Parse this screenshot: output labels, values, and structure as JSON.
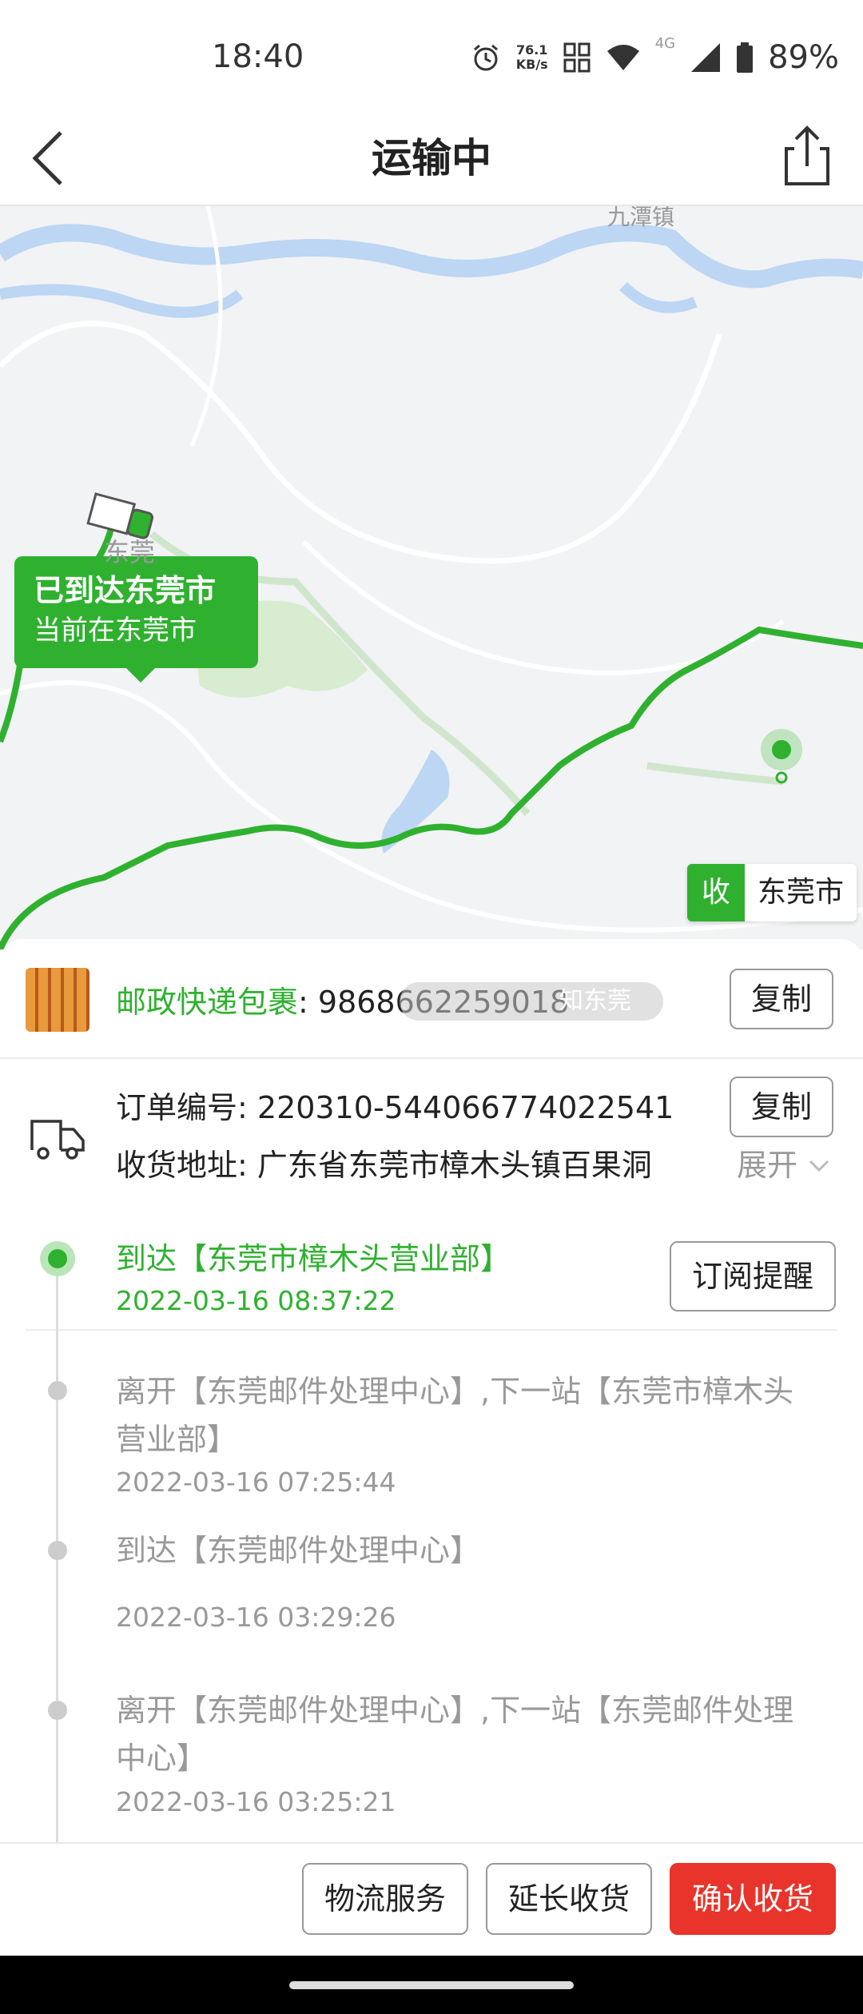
{
  "status_bar": {
    "time": "18:40",
    "speed_value": "76.1",
    "speed_unit": "KB/s",
    "network": "4G",
    "battery": "89%"
  },
  "header": {
    "title": "运输中",
    "back_icon": "chevron-left-icon",
    "share_icon": "share-icon"
  },
  "map": {
    "callout_title": "已到达东莞市",
    "callout_subtitle": "当前在东莞市",
    "city_label": "东莞",
    "top_label": "九潭镇",
    "destination_badge": "收",
    "destination_city": "东莞市",
    "route_color": "#2fb12f"
  },
  "package": {
    "carrier": "邮政快递包裹",
    "tracking_number": "9868662259018",
    "watermark": "知东莞",
    "copy_label": "复制"
  },
  "order": {
    "order_label": "订单编号: ",
    "order_number": "220310-544066774022541",
    "copy_label": "复制",
    "address_label": "收货地址: ",
    "address": "广东省东莞市樟木头镇百果洞",
    "expand_label": "展开"
  },
  "timeline": {
    "subscribe_label": "订阅提醒",
    "events": [
      {
        "title": "到达【东莞市樟木头营业部】",
        "time": "2022-03-16 08:37:22"
      },
      {
        "title": "离开【东莞邮件处理中心】,下一站【东莞市樟木头营业部】",
        "time": "2022-03-16 07:25:44"
      },
      {
        "title": "到达【东莞邮件处理中心】",
        "time": "2022-03-16 03:29:26"
      },
      {
        "title": "离开【东莞邮件处理中心】,下一站【东莞邮件处理中心】",
        "time": "2022-03-16 03:25:21"
      }
    ]
  },
  "bottom_bar": {
    "logistics_service": "物流服务",
    "extend_receipt": "延长收货",
    "confirm_receipt": "确认收货"
  },
  "colors": {
    "accent_green": "#2fb12f",
    "confirm_red": "#e8342a"
  }
}
